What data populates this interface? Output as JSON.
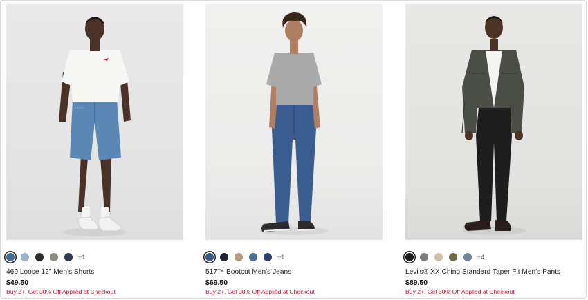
{
  "products": [
    {
      "name": "469 Loose 12\" Men's Shorts",
      "price": "$49.50",
      "promo": "Buy 2+, Get 30% Off Applied at Checkout",
      "more_colors": "+1",
      "swatches": [
        "#3e6a9a",
        "#98b4c8",
        "#2b2b28",
        "#8a8c80",
        "#2e3a58"
      ],
      "image": "model-in-white-tee-and-denim-shorts"
    },
    {
      "name": "517™ Bootcut Men's Jeans",
      "price": "$69.50",
      "promo": "Buy 2+, Get 30% Off Applied at Checkout",
      "more_colors": "+1",
      "swatches": [
        "#355a86",
        "#1c2438",
        "#b39a78",
        "#4b6e98",
        "#2f3f72"
      ],
      "image": "model-in-grey-tee-and-bootcut-jeans"
    },
    {
      "name": "Levi's® XX Chino Standard Taper Fit Men's Pants",
      "price": "$89.50",
      "promo": "Buy 2+, Get 30% Off Applied at Checkout",
      "more_colors": "+4",
      "swatches": [
        "#1a1a1a",
        "#7b7b78",
        "#d2bea2",
        "#6f6a44",
        "#6b84a0"
      ],
      "image": "model-in-jacket-and-black-chinos"
    }
  ],
  "colors": {
    "promo_red": "#c8102e",
    "price_black": "#111111"
  }
}
